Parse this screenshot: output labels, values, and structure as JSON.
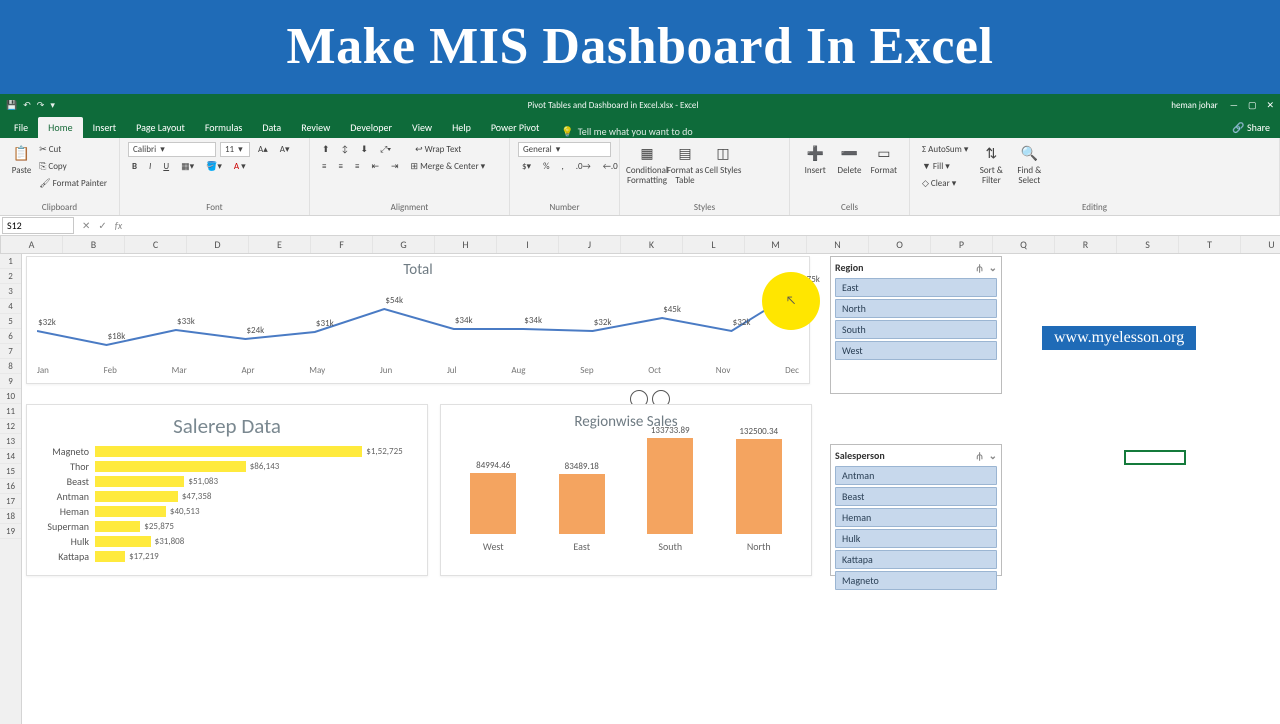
{
  "banner": "Make MIS Dashboard  In Excel",
  "titlebar": {
    "doc": "Pivot Tables and Dashboard in Excel.xlsx - Excel",
    "user": "heman johar"
  },
  "tabs": [
    "File",
    "Home",
    "Insert",
    "Page Layout",
    "Formulas",
    "Data",
    "Review",
    "Developer",
    "View",
    "Help",
    "Power Pivot"
  ],
  "tellme": "Tell me what you want to do",
  "share": "Share",
  "ribbon": {
    "clipboard": {
      "paste": "Paste",
      "cut": "Cut",
      "copy": "Copy",
      "fp": "Format Painter",
      "lbl": "Clipboard"
    },
    "font": {
      "name": "Calibri",
      "size": "11",
      "lbl": "Font"
    },
    "align": {
      "wrap": "Wrap Text",
      "merge": "Merge & Center",
      "lbl": "Alignment"
    },
    "number": {
      "fmt": "General",
      "lbl": "Number"
    },
    "styles": {
      "cf": "Conditional Formatting",
      "fat": "Format as Table",
      "cs": "Cell Styles",
      "lbl": "Styles"
    },
    "cells": {
      "ins": "Insert",
      "del": "Delete",
      "fmt": "Format",
      "lbl": "Cells"
    },
    "editing": {
      "as": "AutoSum",
      "fill": "Fill",
      "clr": "Clear",
      "sort": "Sort & Filter",
      "find": "Find & Select",
      "lbl": "Editing"
    }
  },
  "namebox": "S12",
  "columns": [
    "A",
    "B",
    "C",
    "D",
    "E",
    "F",
    "G",
    "H",
    "I",
    "J",
    "K",
    "L",
    "M",
    "N",
    "O",
    "P",
    "Q",
    "R",
    "S",
    "T",
    "U"
  ],
  "rows_max": 19,
  "watermark": "www.myelesson.org",
  "slicer_region": {
    "title": "Region",
    "items": [
      "East",
      "North",
      "South",
      "West"
    ]
  },
  "slicer_person": {
    "title": "Salesperson",
    "items": [
      "Antman",
      "Beast",
      "Heman",
      "Hulk",
      "Kattapa",
      "Magneto"
    ]
  },
  "chart_data": [
    {
      "type": "line",
      "title": "Total",
      "categories": [
        "Jan",
        "Feb",
        "Mar",
        "Apr",
        "May",
        "Jun",
        "Jul",
        "Aug",
        "Sep",
        "Oct",
        "Nov",
        "Dec"
      ],
      "values": [
        32,
        18,
        33,
        24,
        31,
        54,
        34,
        34,
        32,
        45,
        32,
        75
      ],
      "value_labels": [
        "$32k",
        "$18k",
        "$33k",
        "$24k",
        "$31k",
        "$54k",
        "$34k",
        "$34k",
        "$32k",
        "$45k",
        "$32k",
        "$75k"
      ],
      "ylim": [
        0,
        80
      ]
    },
    {
      "type": "bar",
      "orientation": "horizontal",
      "title": "Salerep Data",
      "categories": [
        "Magneto",
        "Thor",
        "Beast",
        "Antman",
        "Heman",
        "Superman",
        "Hulk",
        "Kattapa"
      ],
      "values": [
        152725,
        86143,
        51083,
        47358,
        40513,
        25875,
        31808,
        17219
      ],
      "value_labels": [
        "$1,52,725",
        "$86,143",
        "$51,083",
        "$47,358",
        "$40,513",
        "$25,875",
        "$31,808",
        "$17,219"
      ],
      "xlim": [
        0,
        160000
      ]
    },
    {
      "type": "bar",
      "title": "Regionwise Sales",
      "categories": [
        "West",
        "East",
        "South",
        "North"
      ],
      "values": [
        84994.46,
        83489.18,
        133733.89,
        132500.34
      ],
      "ylim": [
        0,
        140000
      ]
    }
  ]
}
